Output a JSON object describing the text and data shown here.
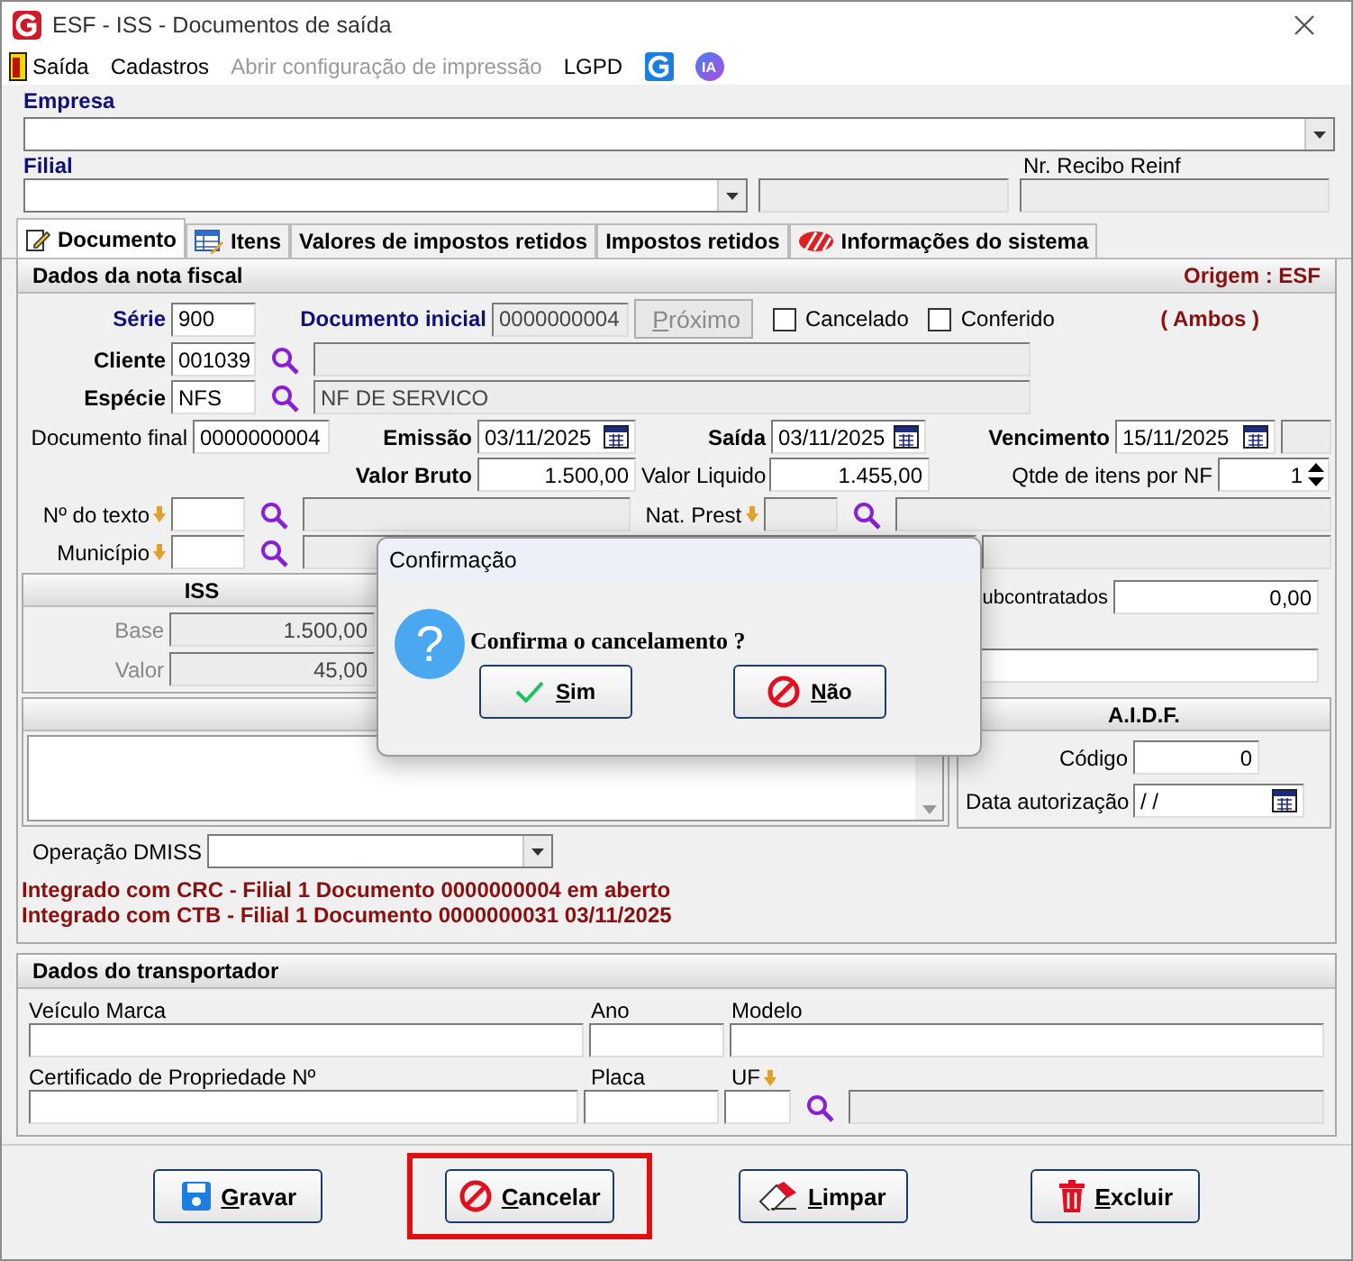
{
  "window": {
    "title": "ESF - ISS - Documentos de saída"
  },
  "menu": [
    {
      "label": "Saída",
      "disabled": false,
      "kind": "exit"
    },
    {
      "label": "Cadastros",
      "disabled": false,
      "kind": "text"
    },
    {
      "label": "Abrir configuração de impressão",
      "disabled": true,
      "kind": "text"
    },
    {
      "label": "LGPD",
      "disabled": false,
      "kind": "text"
    },
    {
      "kind": "brand"
    },
    {
      "label": "IA",
      "disabled": false,
      "kind": "ai"
    }
  ],
  "empresa": {
    "label": "Empresa"
  },
  "filial": {
    "label": "Filial"
  },
  "recibo_reinf": {
    "label": "Nr. Recibo Reinf"
  },
  "tabs": [
    {
      "label": "Documento",
      "selected": true
    },
    {
      "label": "Itens",
      "selected": false
    },
    {
      "label": "Valores de impostos retidos",
      "selected": false
    },
    {
      "label": "Impostos retidos",
      "selected": false
    },
    {
      "label": "Informações do sistema",
      "selected": false
    }
  ],
  "nota_fiscal": {
    "title": "Dados da nota fiscal",
    "origem": "Origem : ESF",
    "ambos": "( Ambos )",
    "serie": {
      "label": "Série",
      "value": "900"
    },
    "documento_inicial": {
      "label": "Documento inicial",
      "value": "0000000004"
    },
    "proximo": {
      "label": "Próximo",
      "disabled": true
    },
    "checkboxes": [
      {
        "label": "Cancelado",
        "checked": false
      },
      {
        "label": "Conferido",
        "checked": false
      }
    ],
    "cliente": {
      "label": "Cliente",
      "value": "001039"
    },
    "especie": {
      "label": "Espécie",
      "value": "NFS",
      "description": "NF DE SERVICO"
    },
    "documento_final": {
      "label": "Documento final",
      "value": "0000000004"
    },
    "emissao": {
      "label": "Emissão",
      "value": "03/11/2025"
    },
    "saida": {
      "label": "Saída",
      "value": "03/11/2025"
    },
    "vencimento": {
      "label": "Vencimento",
      "value": "15/11/2025"
    },
    "valor_bruto": {
      "label": "Valor Bruto",
      "value": "1.500,00"
    },
    "valor_liquido": {
      "label": "Valor Liquido",
      "value": "1.455,00"
    },
    "qtde_itens": {
      "label": "Qtde de itens por NF",
      "value": "1"
    },
    "numero_texto": {
      "label": "Nº do texto"
    },
    "nat_prest": {
      "label": "Nat. Prest"
    },
    "municipio": {
      "label": "Município"
    },
    "iss": {
      "title": "ISS",
      "base": {
        "label": "Base",
        "value": "1.500,00"
      },
      "valor": {
        "label": "Valor",
        "value": "45,00"
      }
    },
    "subcontratados": {
      "label": "ubcontratados",
      "value": "0,00"
    },
    "aidf": {
      "title": "A.I.D.F.",
      "codigo": {
        "label": "Código",
        "value": "0"
      },
      "data_autorizacao": {
        "label": "Data autorização",
        "value": "/ /"
      }
    },
    "operacao_dmiss": {
      "label": "Operação DMISS"
    },
    "messages": [
      "Integrado com CRC - Filial 1 Documento 0000000004 em aberto",
      "Integrado com CTB - Filial 1 Documento 0000000031 03/11/2025"
    ]
  },
  "transportador": {
    "title": "Dados do transportador",
    "veiculo_marca": "Veículo Marca",
    "ano": "Ano",
    "modelo": "Modelo",
    "certificado": "Certificado de Propriedade Nº",
    "placa": "Placa",
    "uf": "UF"
  },
  "buttons": [
    {
      "label": "Gravar",
      "kind": "save",
      "highlighted": false
    },
    {
      "label": "Cancelar",
      "kind": "cancel",
      "highlighted": true
    },
    {
      "label": "Limpar",
      "kind": "clear",
      "highlighted": false
    },
    {
      "label": "Excluir",
      "kind": "delete",
      "highlighted": false
    }
  ],
  "dialog": {
    "title": "Confirmação",
    "icon": "?",
    "message": "Confirma o cancelamento ?",
    "buttons": [
      {
        "label": "Sim",
        "kind": "yes"
      },
      {
        "label": "Não",
        "kind": "no"
      }
    ]
  }
}
